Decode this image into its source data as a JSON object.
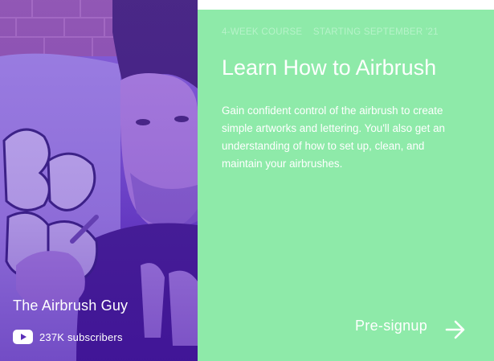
{
  "creator": {
    "name": "The Airbrush Guy",
    "subscribers": "237K subscribers",
    "platform_icon": "youtube-icon"
  },
  "course": {
    "duration": "4-WEEK COURSE",
    "start": "STARTING SEPTEMBER '21",
    "title": "Learn How to Airbrush",
    "description": "Gain confident control of the airbrush to create simple artworks and lettering. You'll also get an understanding of how to set up, clean, and maintain your airbrushes."
  },
  "cta": {
    "label": "Pre-signup",
    "icon": "arrow-right-icon"
  },
  "colors": {
    "info_panel": "#8eeaa9",
    "meta_text": "#b6f3c9",
    "photo_tint": "#6a3fc8"
  }
}
